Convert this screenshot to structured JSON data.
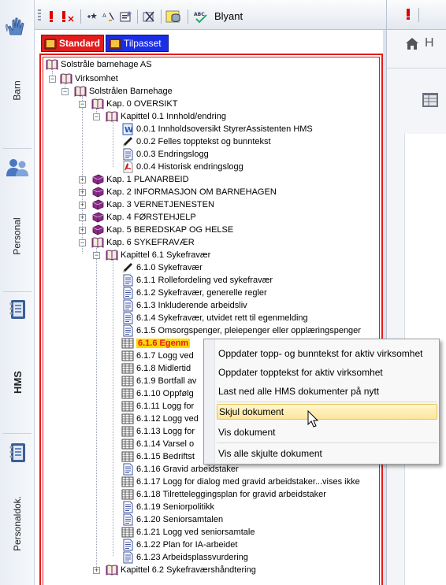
{
  "sidebar": {
    "items": [
      {
        "label": "Barn",
        "icon": "hand-icon"
      },
      {
        "label": "Personal",
        "icon": "people-icon"
      },
      {
        "label": "HMS",
        "icon": "notebook-icon",
        "active": true
      },
      {
        "label": "Personaldok.",
        "icon": "notebook-icon"
      }
    ]
  },
  "toolbar": {
    "blyant_label": "Blyant",
    "icons": [
      "exclamation-icon",
      "exclamation-x-icon",
      "star-icon",
      "sort-icon",
      "form-icon",
      "delete-icon",
      "database-icon",
      "spellcheck-icon"
    ]
  },
  "tabs": [
    {
      "label": "Standard",
      "color": "#e31b1b"
    },
    {
      "label": "Tilpasset",
      "color": "#1a2ee6"
    }
  ],
  "tree": {
    "org": "Solstråle barnehage AS",
    "virksomhet": "Virksomhet",
    "barnehage": "Solstrålen Barnehage",
    "kap0": "Kap. 0  OVERSIKT",
    "kapittel01": "Kapittel 0.1 Innhold/endring",
    "doc001": "0.0.1 Innholdsoversikt StyrerAssistenten HMS",
    "doc002": "0.0.2 Felles topptekst og bunntekst",
    "doc003": "0.0.3 Endringslogg",
    "doc004": "0.0.4 Historisk endringslogg",
    "kap1": "Kap. 1  PLANARBEID",
    "kap2": "Kap. 2  INFORMASJON OM BARNEHAGEN",
    "kap3": "Kap. 3  VERNETJENESTEN",
    "kap4": "Kap. 4  FØRSTEHJELP",
    "kap5": "Kap. 5  BEREDSKAP OG HELSE",
    "kap6": "Kap. 6  SYKEFRAVÆR",
    "kapittel61": "Kapittel 6.1 Sykefravær",
    "d610": "6.1.0 Sykefravær",
    "d611": "6.1.1 Rollefordeling ved sykefravær",
    "d612": "6.1.2 Sykefravær, generelle regler",
    "d613": "6.1.3 Inkluderende arbeidsliv",
    "d614": "6.1.4 Sykefravær, utvidet rett til egenmelding",
    "d615": "6.1.5 Omsorgspenger, pleiepenger eller opplæringspenger",
    "d616": "6.1.6 Egenm",
    "d617": "6.1.7 Logg ved",
    "d618": "6.1.8 Midlertid",
    "d619": "6.1.9 Bortfall av",
    "d6110": "6.1.10 Oppfølg",
    "d6111": "6.1.11 Logg for",
    "d6112": "6.1.12 Logg ved",
    "d6113": "6.1.13 Logg for",
    "d6114": "6.1.14 Varsel o",
    "d6115": "6.1.15 Bedriftst",
    "d6116": "6.1.16 Gravid arbeidstaker",
    "d6117": "6.1.17 Logg for dialog med gravid arbeidstaker...vises ikke",
    "d6118": "6.1.18 Tilretteleggingsplan for gravid arbeidstaker",
    "d6119": "6.1.19 Seniorpolitikk",
    "d6120": "6.1.20 Seniorsamtalen",
    "d6121": "6.1.21 Logg ved seniorsamtale",
    "d6122": "6.1.22 Plan for IA-arbeidet",
    "d6123": "6.1.23 Arbeidsplassvurdering",
    "kapittel62": "Kapittel 6.2 Sykefraværshåndtering"
  },
  "context_menu": {
    "items": [
      "Oppdater topp- og bunntekst for aktiv virksomhet",
      "Oppdater topptekst for aktiv virksomhet",
      "Last ned alle HMS dokumenter på nytt",
      "Skjul dokument",
      "Vis dokument",
      "Vis alle skjulte dokument"
    ],
    "hovered_index": 3
  },
  "right_panel": {
    "home_label": "H"
  },
  "colors": {
    "accent_red": "#e31b1b",
    "accent_blue": "#1a2ee6",
    "highlight": "#ffd800"
  }
}
